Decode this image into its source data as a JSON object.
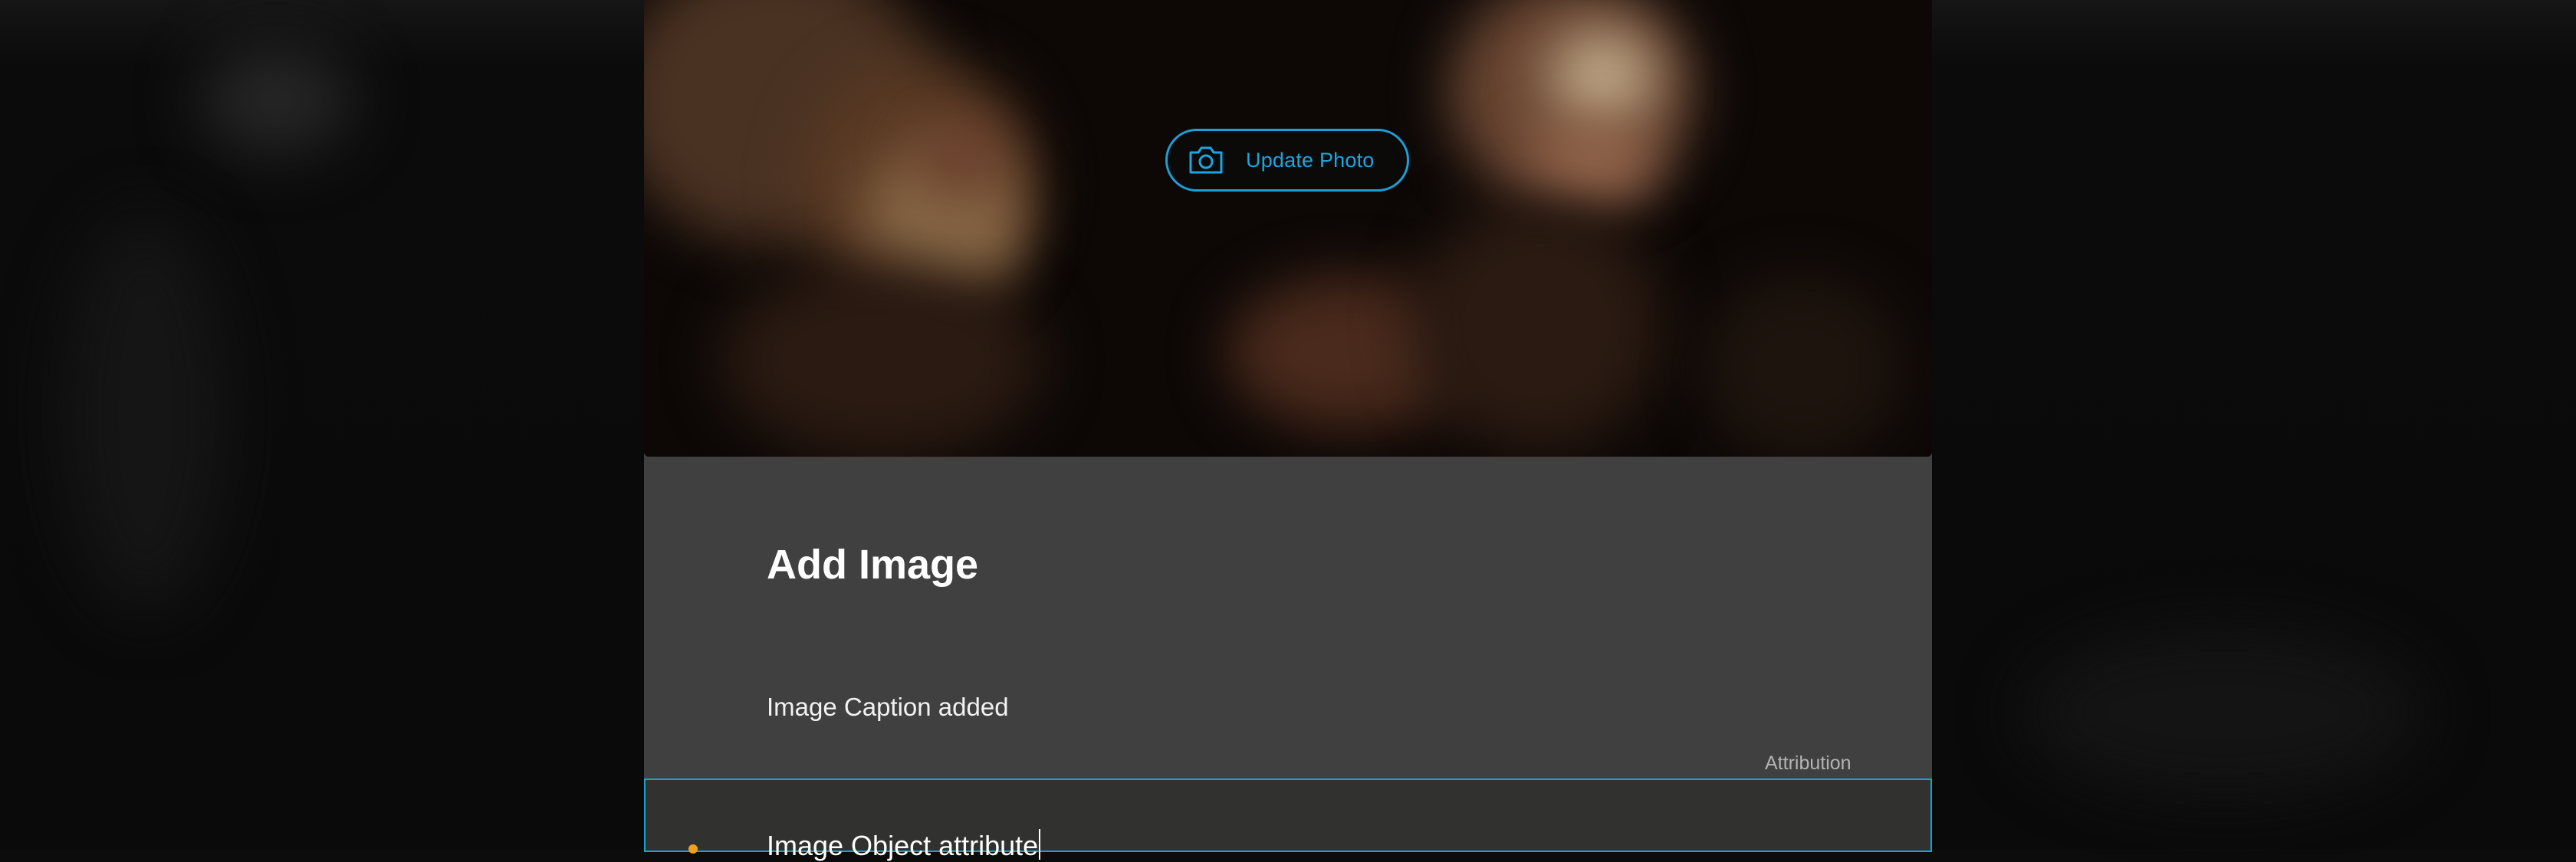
{
  "modal": {
    "update_photo_label": "Update Photo",
    "title": "Add Image",
    "caption_text": "Image Caption added",
    "attribution_label": "Attribution",
    "attribution_value": "Image Object attribute"
  },
  "icons": {
    "camera": "camera-icon"
  },
  "colors": {
    "accent": "#1a9fd6",
    "modal_bg": "#404040",
    "field_bg": "#313130",
    "backdrop": "#0c0c0c"
  }
}
